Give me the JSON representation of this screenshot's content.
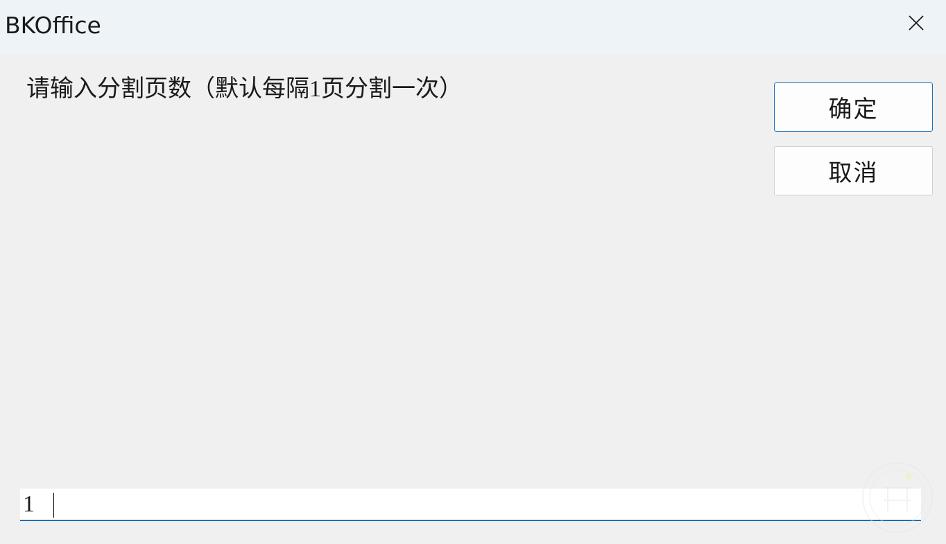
{
  "window": {
    "title": "BKOffice"
  },
  "dialog": {
    "prompt": "请输入分割页数（默认每隔1页分割一次）",
    "ok_label": "确定",
    "cancel_label": "取消"
  },
  "input": {
    "value": "1"
  },
  "icons": {
    "close": "close-icon",
    "watermark": "watermark-logo"
  },
  "colors": {
    "accent": "#1f6fb4",
    "titlebar": "#eef3f8",
    "background": "#f0f0f0"
  }
}
